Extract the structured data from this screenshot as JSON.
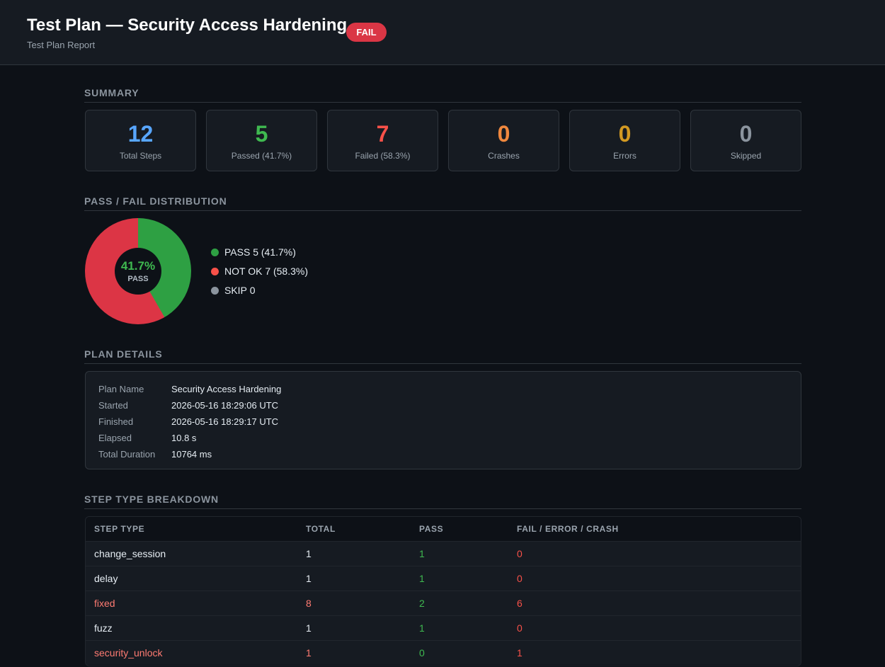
{
  "header": {
    "title": "Test Plan — Security Access Hardening",
    "badge": "FAIL",
    "subtitle": "Test Plan Report"
  },
  "summary": {
    "title": "SUMMARY",
    "cards": [
      {
        "value": "12",
        "label": "Total Steps",
        "color": "#58a6ff"
      },
      {
        "value": "5",
        "label": "Passed (41.7%)",
        "color": "#3fb950"
      },
      {
        "value": "7",
        "label": "Failed (58.3%)",
        "color": "#f85149"
      },
      {
        "value": "0",
        "label": "Crashes",
        "color": "#f0883e"
      },
      {
        "value": "0",
        "label": "Errors",
        "color": "#d29922"
      },
      {
        "value": "0",
        "label": "Skipped",
        "color": "#8b949e"
      }
    ]
  },
  "distribution": {
    "title": "PASS / FAIL DISTRIBUTION",
    "center_pct": "41.7%",
    "center_label": "PASS",
    "pass_fraction": 0.417,
    "legend": [
      {
        "name": "PASS",
        "text": "5 (41.7%)",
        "color": "#2ea043"
      },
      {
        "name": "NOT OK",
        "text": "7 (58.3%)",
        "color": "#f85149"
      },
      {
        "name": "SKIP",
        "text": "0",
        "color": "#8b949e"
      }
    ]
  },
  "plan_details": {
    "title": "PLAN DETAILS",
    "rows": [
      {
        "key": "Plan Name",
        "value": "Security Access Hardening"
      },
      {
        "key": "Started",
        "value": "2026-05-16 18:29:06 UTC"
      },
      {
        "key": "Finished",
        "value": "2026-05-16 18:29:17 UTC"
      },
      {
        "key": "Elapsed",
        "value": "10.8 s"
      },
      {
        "key": "Total Duration",
        "value": "10764 ms"
      }
    ]
  },
  "breakdown": {
    "title": "STEP TYPE BREAKDOWN",
    "headers": [
      "STEP TYPE",
      "TOTAL",
      "PASS",
      "FAIL / ERROR / CRASH"
    ],
    "rows": [
      {
        "type": "change_session",
        "total": "1",
        "pass": "1",
        "fail": "0"
      },
      {
        "type": "delay",
        "total": "1",
        "pass": "1",
        "fail": "0"
      },
      {
        "type": "fixed",
        "total": "8",
        "pass": "2",
        "fail": "6"
      },
      {
        "type": "fuzz",
        "total": "1",
        "pass": "1",
        "fail": "0"
      },
      {
        "type": "security_unlock",
        "total": "1",
        "pass": "0",
        "fail": "1"
      }
    ]
  },
  "colors": {
    "background": "#0d1117",
    "panel": "#161b22",
    "fail_badge": "#da3645",
    "pass": "#3fb950",
    "fail": "#f85149"
  }
}
